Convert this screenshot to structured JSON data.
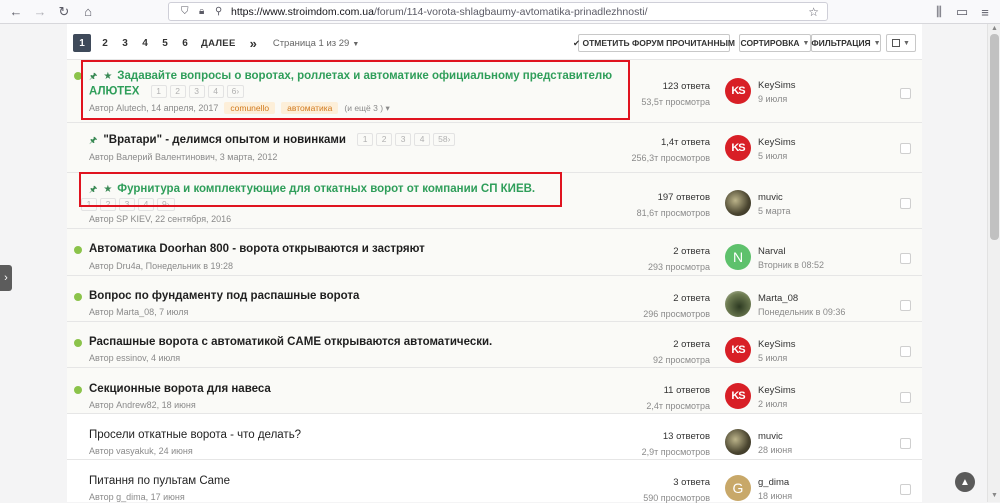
{
  "browser": {
    "url_host": "https://www.stroimdom.com.ua",
    "url_path": "/forum/114-vorota-shlagbaumy-avtomatika-prinadlezhnosti/"
  },
  "pager": {
    "pages": [
      "1",
      "2",
      "3",
      "4",
      "5",
      "6"
    ],
    "next": "ДАЛЕЕ",
    "last": "»",
    "info": "Страница 1 из 29"
  },
  "toolbar": {
    "mark_read": "✔ ОТМЕТИТЬ ФОРУМ ПРОЧИТАННЫМ",
    "sort": "СОРТИРОВКА",
    "filter": "ФИЛЬТРАЦИЯ"
  },
  "topics": [
    {
      "title_line1": "Задавайте вопросы о воротах, роллетах и автоматике официальному представителю",
      "title_line2": "АЛЮТЕХ",
      "mini_pages": [
        "1",
        "2",
        "3",
        "4",
        "6›"
      ],
      "meta": "Автор Alutech, 14 апреля, 2017",
      "tags": [
        "comunello",
        "автоматика"
      ],
      "more": "(и ещё 3 )",
      "replies": "123 ответа",
      "views": "53,5т просмотра",
      "last_user": "KeySims",
      "last_date": "9 июля"
    },
    {
      "title": "\"Вратари\" - делимся опытом и новинками",
      "mini_pages": [
        "1",
        "2",
        "3",
        "4",
        "58›"
      ],
      "meta": "Автор Валерий Валентинович, 3 марта, 2012",
      "replies": "1,4т ответа",
      "views": "256,3т просмотров",
      "last_user": "KeySims",
      "last_date": "5 июля"
    },
    {
      "title": "Фурнитура и комплектующие для откатных ворот от компании СП КИЕВ.",
      "mini_pages": [
        "1",
        "2",
        "3",
        "4",
        "9›"
      ],
      "meta": "Автор SP KIEV, 22 сентября, 2016",
      "replies": "197 ответов",
      "views": "81,6т просмотров",
      "last_user": "muvic",
      "last_date": "5 марта"
    },
    {
      "title": "Автоматика Doorhan 800 - ворота открываются и застряют",
      "meta": "Автор Dru4a, Понедельник в 19:28",
      "replies": "2 ответа",
      "views": "293 просмотра",
      "last_user": "Narval",
      "last_date": "Вторник в 08:52",
      "avatar_letter": "N"
    },
    {
      "title": "Вопрос по фундаменту под распашные ворота",
      "meta": "Автор Marta_08, 7 июля",
      "replies": "2 ответа",
      "views": "296 просмотров",
      "last_user": "Marta_08",
      "last_date": "Понедельник в 09:36"
    },
    {
      "title": "Распашные ворота с автоматикой CAME открываются автоматически.",
      "meta": "Автор essinov, 4 июля",
      "replies": "2 ответа",
      "views": "92 просмотра",
      "last_user": "KeySims",
      "last_date": "5 июля"
    },
    {
      "title": "Секционные ворота для навеса",
      "meta": "Автор Andrew82, 18 июня",
      "replies": "11 ответов",
      "views": "2,4т просмотра",
      "last_user": "KeySims",
      "last_date": "2 июля"
    },
    {
      "title": "Просели откатные ворота - что делать?",
      "meta": "Автор vasyakuk, 24 июня",
      "replies": "13 ответов",
      "views": "2,9т просмотров",
      "last_user": "muvic",
      "last_date": "28 июня"
    },
    {
      "title": "Питання по пультам Came",
      "meta": "Автор g_dima, 17 июня",
      "replies": "3 ответа",
      "views": "590 просмотров",
      "last_user": "g_dima",
      "last_date": "18 июня",
      "avatar_letter": "G"
    }
  ],
  "avatar_ks_text": "KS"
}
